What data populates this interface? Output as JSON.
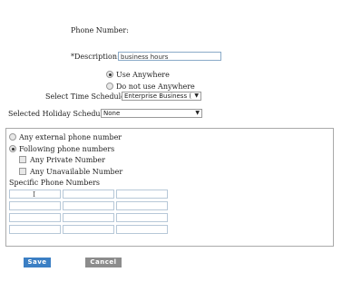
{
  "form": {
    "phone_number_label": "Phone Number:",
    "description_label": "*Description:",
    "description_value": "business hours",
    "use_anywhere_label": "Use Anywhere",
    "do_not_use_label": "Do not use Anywhere",
    "time_schedule_label": "Select Time Schedule:",
    "time_schedule_value": "Enterprise Business (",
    "holiday_schedule_label": "Selected Holiday Schedule:",
    "holiday_schedule_value": "None"
  },
  "criteria": {
    "any_external_label": "Any external phone number",
    "following_label": "Following phone numbers",
    "any_private_label": "Any Private Number",
    "any_unavailable_label": "Any Unavailable Number",
    "specific_label": "Specific Phone Numbers"
  },
  "buttons": {
    "save": "Save",
    "cancel": "Cancel"
  },
  "colors": {
    "save_bg": "#3b7fc4",
    "cancel_bg": "#8c8c8c"
  }
}
